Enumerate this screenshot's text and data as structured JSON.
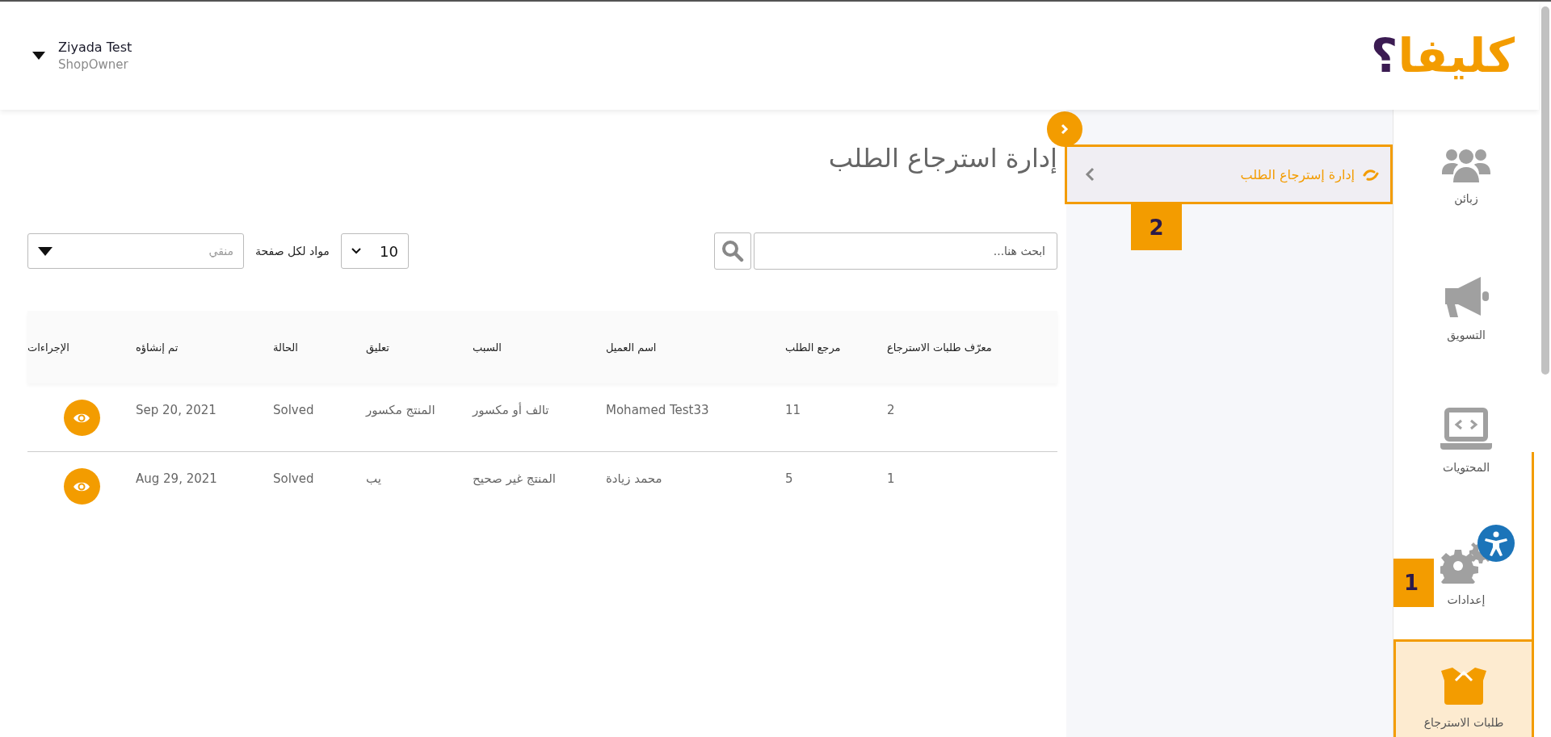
{
  "header": {
    "user_name": "Ziyada Test",
    "user_role": "ShopOwner",
    "logo_text": "كليفا",
    "logo_mark": "؟"
  },
  "sidebar": {
    "tour_badge": "1",
    "items": [
      {
        "label": "زبائن",
        "selected": false
      },
      {
        "label": "التسويق",
        "selected": false
      },
      {
        "label": "المحتويات",
        "selected": false
      },
      {
        "label": "إعدادات",
        "selected": false
      },
      {
        "label": "طلبات الاسترجاع",
        "selected": true
      }
    ]
  },
  "submenu": {
    "tour_badge": "2",
    "items": [
      {
        "label": "إدارة إسترجاع الطلب",
        "selected": true
      }
    ]
  },
  "page": {
    "title": "إدارة استرجاع الطلب",
    "search": {
      "placeholder": "ابحث هنا..."
    },
    "per_page": {
      "label": "مواد لكل صفحة",
      "value": "10"
    },
    "filter": {
      "placeholder": "منقي"
    }
  },
  "table": {
    "columns": [
      "معرّف طلبات الاسترجاع",
      "مرجع الطلب",
      "اسم العميل",
      "السبب",
      "تعليق",
      "الحالة",
      "تم إنشاؤه",
      "الإجراءات"
    ],
    "rows": [
      {
        "cells": [
          "2",
          "11",
          "Mohamed Test33",
          "تالف أو مكسور",
          "المنتج مكسور",
          "Solved",
          "Sep 20, 2021"
        ]
      },
      {
        "cells": [
          "1",
          "5",
          "محمد زيادة",
          "المنتج غير صحيح",
          "يب",
          "Solved",
          "Aug 29, 2021"
        ]
      }
    ]
  }
}
